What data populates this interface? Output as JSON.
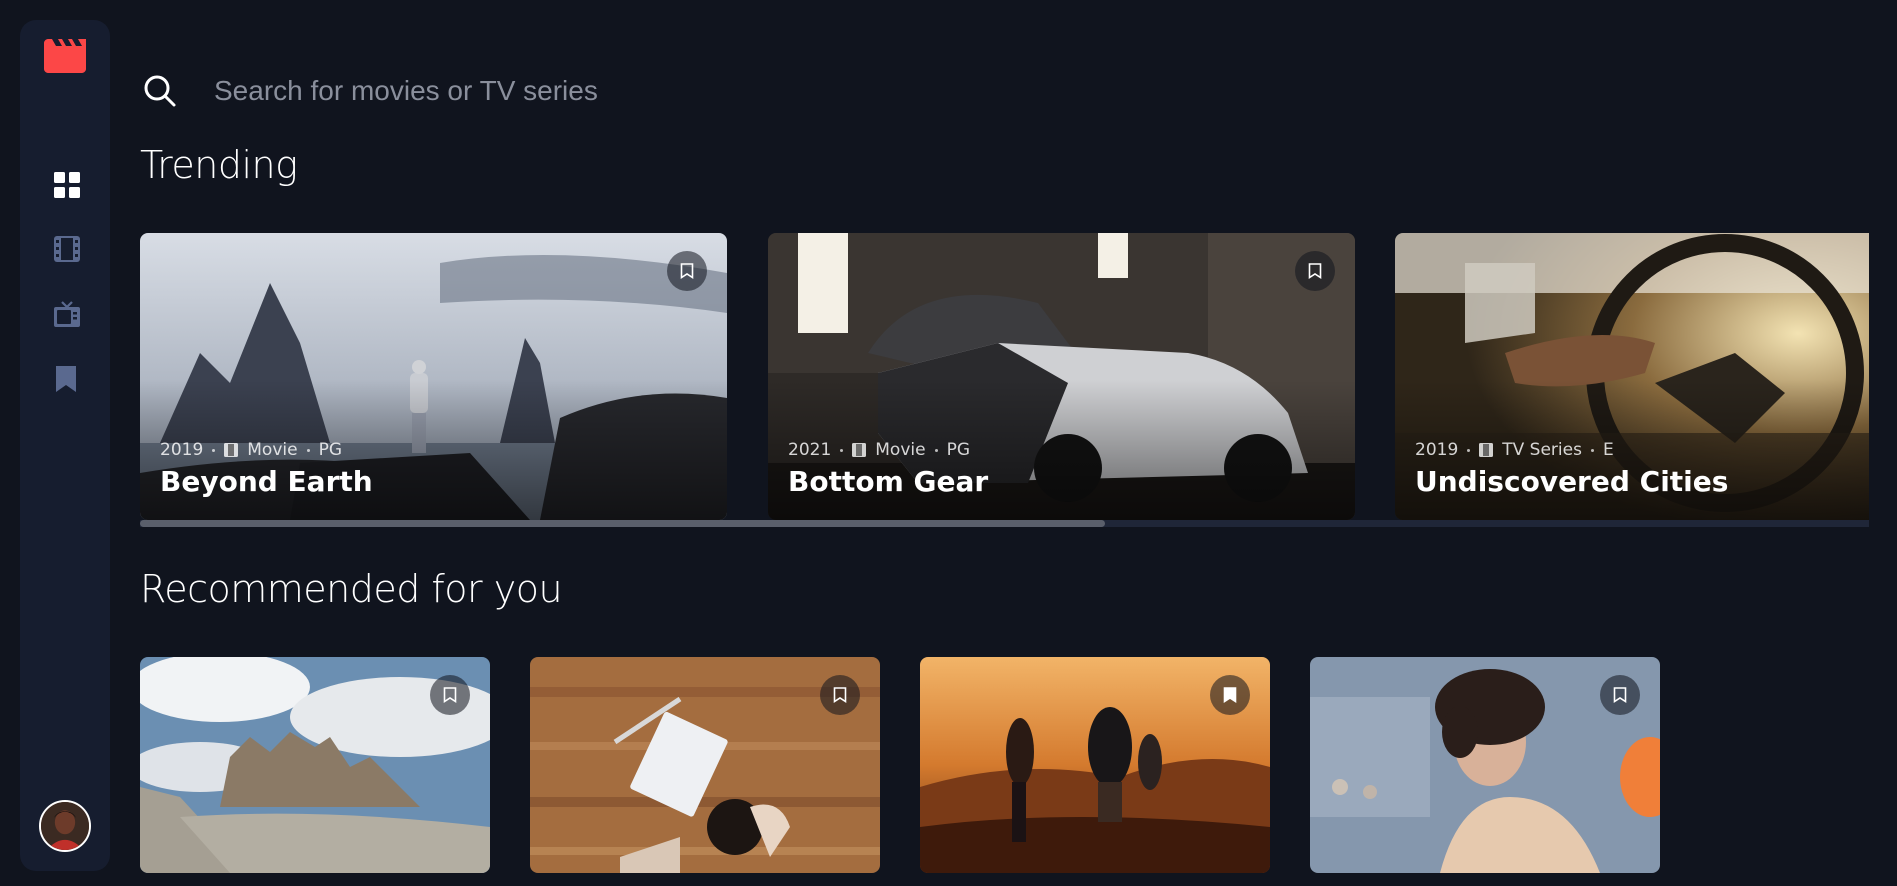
{
  "search": {
    "placeholder": "Search for movies or TV series",
    "value": ""
  },
  "sidebar": {
    "logo_icon": "clapperboard-icon",
    "accent_color": "#fc4747",
    "items": [
      {
        "id": "home",
        "icon": "grid-icon",
        "active": true
      },
      {
        "id": "movies",
        "icon": "film-icon",
        "active": false
      },
      {
        "id": "tv-series",
        "icon": "tv-icon",
        "active": false
      },
      {
        "id": "bookmarks",
        "icon": "bookmark-icon",
        "active": false
      }
    ],
    "avatar_icon": "user-avatar"
  },
  "sections": {
    "trending": {
      "title": "Trending"
    },
    "recommended": {
      "title": "Recommended for you"
    }
  },
  "trending": [
    {
      "year": "2019",
      "category": "Movie",
      "rating": "PG",
      "title": "Beyond Earth",
      "bookmarked": false
    },
    {
      "year": "2021",
      "category": "Movie",
      "rating": "PG",
      "title": "Bottom Gear",
      "bookmarked": false
    },
    {
      "year": "2019",
      "category": "TV Series",
      "rating": "E",
      "title": "Undiscovered Cities",
      "bookmarked": false
    }
  ],
  "recommended": [
    {
      "bookmarked": false
    },
    {
      "bookmarked": false
    },
    {
      "bookmarked": true
    },
    {
      "bookmarked": false
    }
  ],
  "colors": {
    "background": "#10141e",
    "surface": "#161d2f",
    "accent": "#fc4747",
    "nav_inactive": "#5a698f"
  }
}
